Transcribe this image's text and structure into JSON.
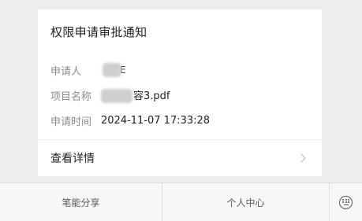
{
  "card": {
    "title": "权限申请审批通知",
    "applicant_label": "申请人",
    "applicant_value_suffix": "E",
    "project_label": "项目名称",
    "project_value_suffix": "容3.pdf",
    "time_label": "申请时间",
    "time_value": "2024-11-07 17:33:28",
    "detail_label": "查看详情"
  },
  "bottom_bar": {
    "tabs": [
      {
        "label": "笔能分享"
      },
      {
        "label": "个人中心"
      }
    ],
    "keyboard_icon": "keyboard-icon"
  }
}
